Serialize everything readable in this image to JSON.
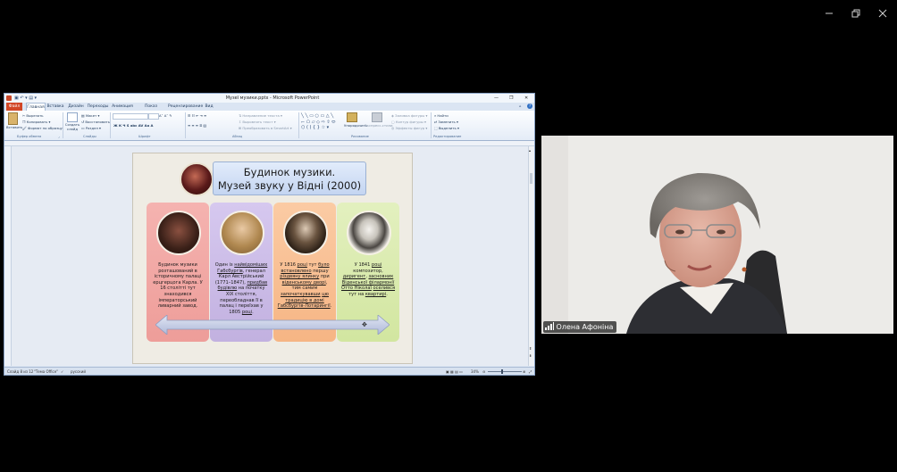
{
  "outer_window": {
    "minimize_icon": "minimize-icon",
    "restore_icon": "restore-icon",
    "close_icon": "close-icon"
  },
  "powerpoint": {
    "title": "Музеї музики.pptx  -  Microsoft PowerPoint",
    "tabs": [
      "Файл",
      "Главная",
      "Вставка",
      "Дизайн",
      "Переходы",
      "Анимация",
      "Показ слайдов",
      "Рецензирование",
      "Вид"
    ],
    "active_tab": "Главная",
    "ribbon": {
      "clipboard": {
        "paste": "Вставить",
        "cut": "Вырезать",
        "copy": "Копировать",
        "format_painter": "Формат по образцу",
        "group": "Буфер обмена"
      },
      "slides": {
        "new_slide": "Создать слайд",
        "layout": "Макет",
        "reset": "Восстановить",
        "section": "Раздел",
        "group": "Слайды"
      },
      "font": {
        "group": "Шрифт"
      },
      "paragraph": {
        "text_direction": "Направление текста",
        "align_text": "Выровнять текст",
        "convert_smartart": "Преобразовать в SmartArt",
        "group": "Абзац"
      },
      "drawing": {
        "arrange": "Упорядочить",
        "quick_styles": "Экспресс-стили",
        "shape_fill": "Заливка фигуры",
        "shape_outline": "Контур фигуры",
        "shape_effects": "Эффекты фигур",
        "group": "Рисование"
      },
      "editing": {
        "find": "Найти",
        "replace": "Заменить",
        "select": "Выделить",
        "group": "Редактирование"
      }
    },
    "status": {
      "slide": "Слайд 8 из 12",
      "theme": "\"Тема Office\"",
      "language": "русский",
      "zoom": "34%"
    }
  },
  "slide": {
    "title_line1": "Будинок музики.",
    "title_line2": "Музей звуку у Відні (2000)",
    "cards": [
      {
        "color": "#f3a9a6",
        "text": "Будинок музики розташований в історичному палаці ерцгерцога Карла. У 16 столітті тут знаходився імператорський ливарний завод."
      },
      {
        "color": "#cdbde8",
        "text_parts": [
          "Один із ",
          "найвідоміших Габсбургів",
          ", генерал Карл Австрійський (1771–1847), ",
          "придбав будівлю",
          " на початку XIX століття, переобладнав її в палац і переїхав у 1805 ",
          "році",
          "."
        ]
      },
      {
        "color": "#f8c49a",
        "text_parts": [
          "У 1816 ",
          "році",
          " тут ",
          "було встановлено",
          " першу ",
          "різдвяну ялинку",
          " при ",
          "віденському дворі",
          ", тим самим ",
          "започаткувавши",
          " ",
          "цю традицію в домі",
          " ",
          "Габсбургів-Лотарингії",
          "."
        ]
      },
      {
        "color": "#dcebb2",
        "text_parts": [
          "У 1841 ",
          "році",
          " композитор, ",
          "диригент",
          ", ",
          "засновник Віденської філармонії",
          " ",
          "Отто Ніколаї",
          " ",
          "оселився",
          " тут на ",
          "квартирі",
          "."
        ]
      }
    ]
  },
  "webcam": {
    "participant_name": "Олена Афоніна",
    "signal_icon": "signal-bars-icon"
  }
}
